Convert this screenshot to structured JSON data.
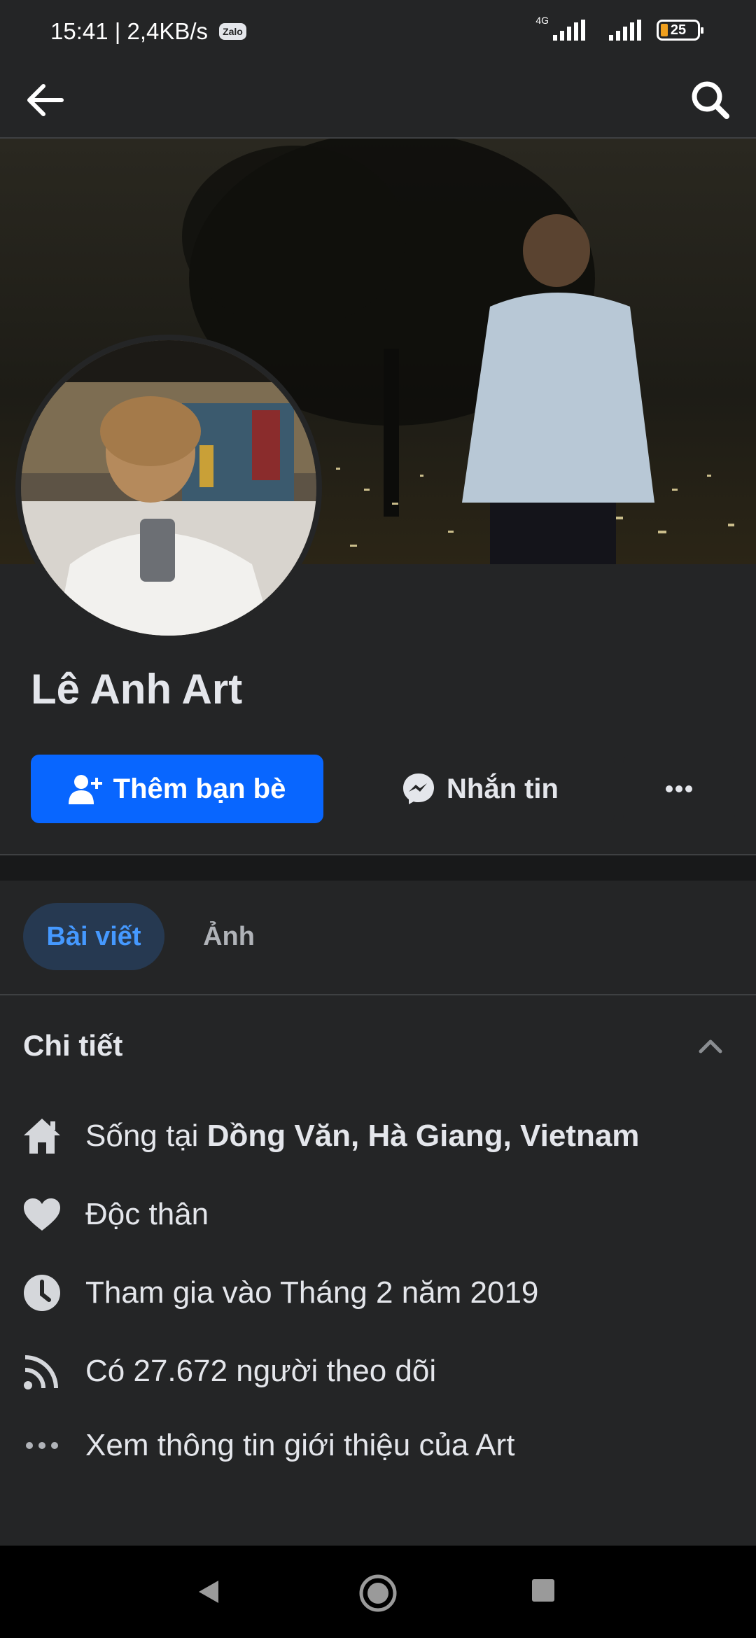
{
  "status_bar": {
    "time_speed": "15:41 | 2,4KB/s",
    "zalo_label": "Zalo",
    "network": "4G",
    "battery": "25"
  },
  "top_bar": {
    "back_icon": "arrow-left-icon",
    "search_icon": "search-icon"
  },
  "profile": {
    "name": "Lê Anh Art"
  },
  "actions": {
    "add_friend": "Thêm bạn bè",
    "message": "Nhắn tin",
    "more_icon": "more-horizontal-icon"
  },
  "tabs": [
    {
      "label": "Bài viết",
      "active": true
    },
    {
      "label": "Ảnh",
      "active": false
    }
  ],
  "details": {
    "title": "Chi tiết",
    "items": [
      {
        "icon": "home-icon",
        "prefix": "Sống tại ",
        "bold": "Dồng Văn, Hà Giang, Vietnam"
      },
      {
        "icon": "heart-icon",
        "text": "Độc thân"
      },
      {
        "icon": "clock-icon",
        "text": "Tham gia vào Tháng 2 năm 2019"
      },
      {
        "icon": "rss-icon",
        "text": "Có 27.672 người theo dõi"
      },
      {
        "icon": "more-dots-icon",
        "text": "Xem thông tin giới thiệu của Art"
      }
    ]
  },
  "colors": {
    "background": "#242526",
    "accent": "#0866ff",
    "tab_active_bg": "#263951",
    "tab_active_text": "#4599ff"
  }
}
